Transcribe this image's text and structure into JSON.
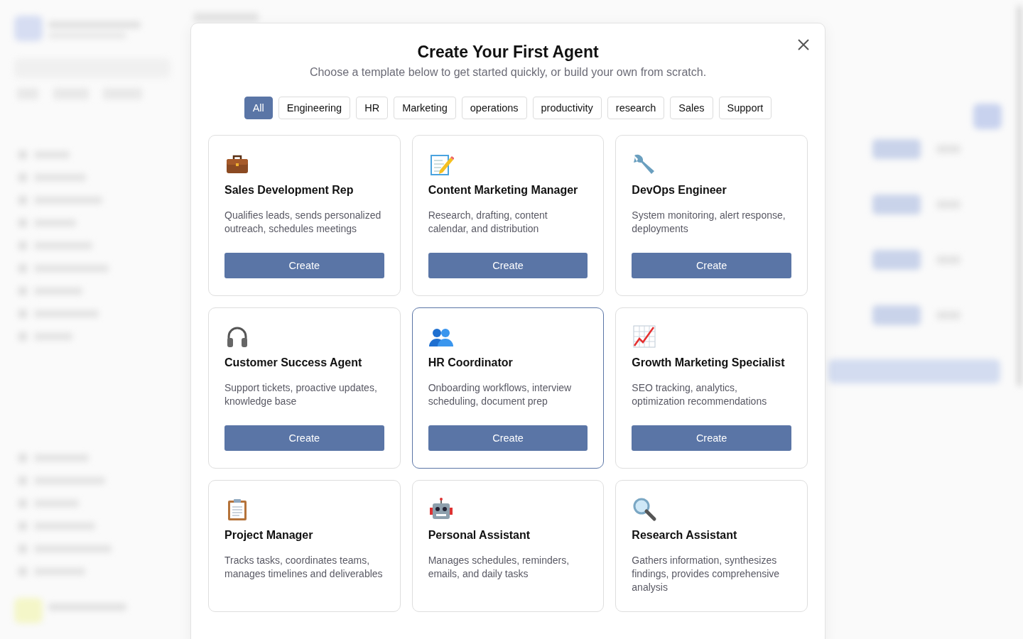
{
  "dialog": {
    "title": "Create Your First Agent",
    "subtitle": "Choose a template below to get started quickly, or build your own from scratch."
  },
  "filters": [
    {
      "label": "All",
      "selected": true
    },
    {
      "label": "Engineering",
      "selected": false
    },
    {
      "label": "HR",
      "selected": false
    },
    {
      "label": "Marketing",
      "selected": false
    },
    {
      "label": "operations",
      "selected": false
    },
    {
      "label": "productivity",
      "selected": false
    },
    {
      "label": "research",
      "selected": false
    },
    {
      "label": "Sales",
      "selected": false
    },
    {
      "label": "Support",
      "selected": false
    }
  ],
  "templates": [
    {
      "kind": "briefcase",
      "name": "Sales Development Rep",
      "description": "Qualifies leads, sends personalized outreach, schedules meetings",
      "button": "Create",
      "selected": false
    },
    {
      "kind": "memo",
      "name": "Content Marketing Manager",
      "description": "Research, drafting, content calendar, and distribution",
      "button": "Create",
      "selected": false
    },
    {
      "kind": "wrench",
      "name": "DevOps Engineer",
      "description": "System monitoring, alert response, deployments",
      "button": "Create",
      "selected": false
    },
    {
      "kind": "headphones",
      "name": "Customer Success Agent",
      "description": "Support tickets, proactive updates, knowledge base",
      "button": "Create",
      "selected": false
    },
    {
      "kind": "people",
      "name": "HR Coordinator",
      "description": "Onboarding workflows, interview scheduling, document prep",
      "button": "Create",
      "selected": true
    },
    {
      "kind": "chart",
      "name": "Growth Marketing Specialist",
      "description": "SEO tracking, analytics, optimization recommendations",
      "button": "Create",
      "selected": false
    },
    {
      "kind": "clipboard",
      "name": "Project Manager",
      "description": "Tracks tasks, coordinates teams, manages timelines and deliverables",
      "selected": false
    },
    {
      "kind": "robot",
      "name": "Personal Assistant",
      "description": "Manages schedules, reminders, emails, and daily tasks",
      "selected": false
    },
    {
      "kind": "magnifier",
      "name": "Research Assistant",
      "description": "Gathers information, synthesizes findings, provides comprehensive analysis",
      "selected": false
    }
  ]
}
